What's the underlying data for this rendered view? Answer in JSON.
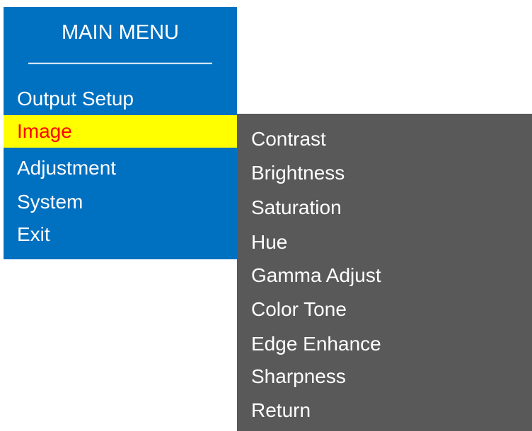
{
  "main_menu": {
    "title": "MAIN MENU",
    "divider": "——————————",
    "items": [
      {
        "label": "Output Setup",
        "selected": false
      },
      {
        "label": "Image",
        "selected": true
      },
      {
        "label": "Adjustment",
        "selected": false
      },
      {
        "label": "System",
        "selected": false
      },
      {
        "label": "Exit",
        "selected": false
      }
    ]
  },
  "submenu": {
    "items": [
      {
        "label": "Contrast"
      },
      {
        "label": "Brightness"
      },
      {
        "label": "Saturation"
      },
      {
        "label": "Hue"
      },
      {
        "label": "Gamma Adjust"
      },
      {
        "label": "Color Tone"
      },
      {
        "label": "Edge Enhance"
      },
      {
        "label": "Sharpness"
      },
      {
        "label": "Return"
      }
    ]
  },
  "colors": {
    "main_bg": "#0070c0",
    "submenu_bg": "#595959",
    "selected_bg": "#ffff00",
    "selected_text": "#ff0000",
    "text": "#ffffff"
  }
}
